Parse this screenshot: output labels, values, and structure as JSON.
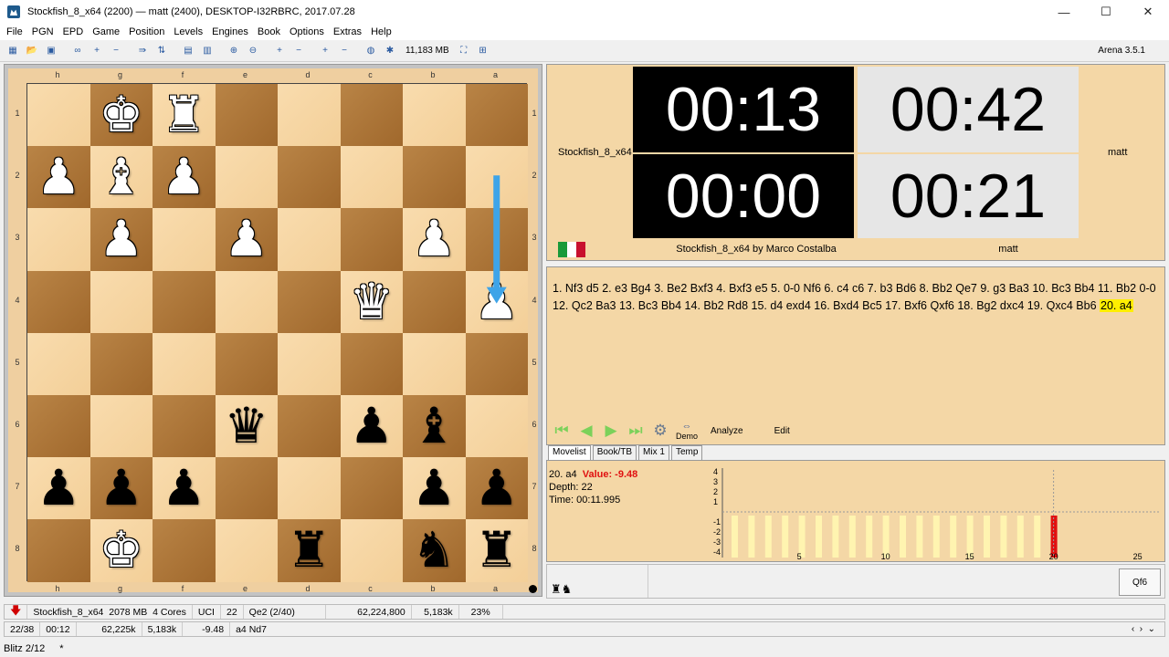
{
  "window": {
    "title": "Stockfish_8_x64 (2200)   —   matt (2400),   DESKTOP-I32RBRC,   2017.07.28",
    "minimize": "—",
    "maximize": "☐",
    "close": "✕"
  },
  "menu": [
    "File",
    "PGN",
    "EPD",
    "Game",
    "Position",
    "Levels",
    "Engines",
    "Book",
    "Options",
    "Extras",
    "Help"
  ],
  "toolbar": {
    "memory": "11,183 MB",
    "version": "Arena 3.5.1"
  },
  "board": {
    "files": [
      "h",
      "g",
      "f",
      "e",
      "d",
      "c",
      "b",
      "a"
    ],
    "ranks": [
      "1",
      "2",
      "3",
      "4",
      "5",
      "6",
      "7",
      "8"
    ],
    "pieces": [
      {
        "file": 1,
        "rank": 0,
        "glyph": "♚",
        "color": "white"
      },
      {
        "file": 2,
        "rank": 0,
        "glyph": "♜",
        "color": "white"
      },
      {
        "file": 0,
        "rank": 1,
        "glyph": "♟",
        "color": "white"
      },
      {
        "file": 1,
        "rank": 1,
        "glyph": "♝",
        "color": "white"
      },
      {
        "file": 2,
        "rank": 1,
        "glyph": "♟",
        "color": "white"
      },
      {
        "file": 1,
        "rank": 2,
        "glyph": "♟",
        "color": "white"
      },
      {
        "file": 3,
        "rank": 2,
        "glyph": "♟",
        "color": "white"
      },
      {
        "file": 6,
        "rank": 2,
        "glyph": "♟",
        "color": "white"
      },
      {
        "file": 5,
        "rank": 3,
        "glyph": "♛",
        "color": "white"
      },
      {
        "file": 7,
        "rank": 3,
        "glyph": "♟",
        "color": "white"
      },
      {
        "file": 3,
        "rank": 5,
        "glyph": "♛",
        "color": "black"
      },
      {
        "file": 5,
        "rank": 5,
        "glyph": "♟",
        "color": "black"
      },
      {
        "file": 6,
        "rank": 5,
        "glyph": "♝",
        "color": "black"
      },
      {
        "file": 0,
        "rank": 6,
        "glyph": "♟",
        "color": "black"
      },
      {
        "file": 1,
        "rank": 6,
        "glyph": "♟",
        "color": "black"
      },
      {
        "file": 2,
        "rank": 6,
        "glyph": "♟",
        "color": "black"
      },
      {
        "file": 6,
        "rank": 6,
        "glyph": "♟",
        "color": "black"
      },
      {
        "file": 7,
        "rank": 6,
        "glyph": "♟",
        "color": "black"
      },
      {
        "file": 1,
        "rank": 7,
        "glyph": "♚",
        "color": "white"
      },
      {
        "file": 4,
        "rank": 7,
        "glyph": "♜",
        "color": "black"
      },
      {
        "file": 6,
        "rank": 7,
        "glyph": "♞",
        "color": "black"
      },
      {
        "file": 7,
        "rank": 7,
        "glyph": "♜",
        "color": "black"
      }
    ],
    "last_move": {
      "from": "a2",
      "to": "a4"
    },
    "arrow_color": "#3ea4e8"
  },
  "clocks": {
    "engine_name": "Stockfish_8_x64",
    "player_name": "matt",
    "top_left": "00:13",
    "bottom_left": "00:00",
    "top_right": "00:42",
    "bottom_right": "00:21",
    "engine_author": "Stockfish_8_x64 by Marco Costalba",
    "player_bottom": "matt"
  },
  "movelist": {
    "text": "1. Nf3 d5 2. e3 Bg4 3. Be2 Bxf3 4. Bxf3 e5 5. 0-0 Nf6 6. c4 c6 7. b3 Bd6 8. Bb2 Qe7 9. g3 Ba3 10. Bc3 Bb4 11. Bb2 0-0 12. Qc2 Ba3 13. Bc3 Bb4 14. Bb2 Rd8 15. d4 exd4 16. Bxd4 Bc5 17. Bxf6 Qxf6 18. Bg2 dxc4 19. Qxc4 Bb6 ",
    "current": "20. a4",
    "demo": "Demo",
    "analyze": "Analyze",
    "edit": "Edit"
  },
  "tabs": [
    "Movelist",
    "Book/TB",
    "Mix 1",
    "Temp"
  ],
  "analysis": {
    "move": "20. a4",
    "value": "Value: -9.48",
    "depth": "Depth: 22",
    "time": "Time: 00:11.995",
    "y_ticks": [
      "4",
      "3",
      "2",
      "1",
      "-1",
      "-2",
      "-3",
      "-4"
    ],
    "x_ticks": [
      "5",
      "10",
      "15",
      "20",
      "25"
    ],
    "bar_color": "#fff4b0",
    "current_bar_color": "#e01010",
    "move_box": "Qf6"
  },
  "status1": {
    "engine": "Stockfish_8_x64",
    "hash": "2078 MB",
    "cores": "4 Cores",
    "protocol": "UCI",
    "depth": "22",
    "current": "Qe2 (2/40)",
    "nodes": "62,224,800",
    "nps": "5,183k",
    "hashfull": "23%"
  },
  "status2": {
    "progress": "22/38",
    "time": "00:12",
    "nodes": "62,225k",
    "nps": "5,183k",
    "score": "-9.48",
    "pv": "a4  Nd7"
  },
  "bottom": {
    "level": "Blitz 2/12",
    "marker": "*"
  }
}
